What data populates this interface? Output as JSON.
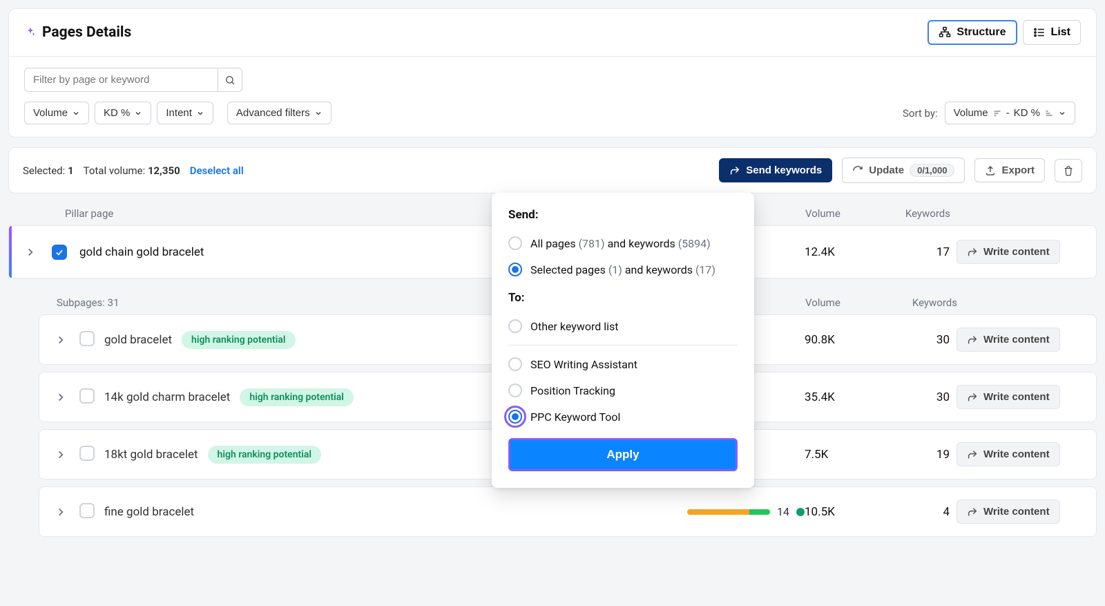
{
  "header": {
    "title": "Pages Details",
    "structure_label": "Structure",
    "list_label": "List"
  },
  "filters": {
    "placeholder": "Filter by page or keyword",
    "volume_label": "Volume",
    "kd_label": "KD %",
    "intent_label": "Intent",
    "advanced_label": "Advanced filters",
    "sortby_label": "Sort by:",
    "sort_value": "Volume",
    "sort_value2": "KD %"
  },
  "selbar": {
    "selected_label": "Selected:",
    "selected_count": "1",
    "total_label": "Total volume:",
    "total_value": "12,350",
    "deselect_label": "Deselect all",
    "send_label": "Send keywords",
    "update_label": "Update",
    "update_badge": "0/1,000",
    "export_label": "Export"
  },
  "columns": {
    "pillar_label": "Pillar page",
    "volume_label": "Volume",
    "keywords_label": "Keywords",
    "subpages_label": "Subpages:",
    "subpages_count": "31"
  },
  "pillar": {
    "title": "gold chain gold bracelet",
    "volume": "12.4K",
    "keywords": "17",
    "write_label": "Write content"
  },
  "subpages": [
    {
      "title": "gold bracelet",
      "tag": "high ranking potential",
      "kd": "",
      "volume": "90.8K",
      "keywords": "30"
    },
    {
      "title": "14k gold charm bracelet",
      "tag": "high ranking potential",
      "kd": "",
      "volume": "35.4K",
      "keywords": "30"
    },
    {
      "title": "18kt gold bracelet",
      "tag": "high ranking potential",
      "kd": "",
      "volume": "7.5K",
      "keywords": "19"
    },
    {
      "title": "fine gold bracelet",
      "tag": "",
      "kd": "14",
      "volume": "10.5K",
      "keywords": "4"
    }
  ],
  "popover": {
    "send_heading": "Send:",
    "opt_all_a": "All pages",
    "opt_all_pages_count": "(781)",
    "opt_all_b": "and keywords",
    "opt_all_kw_count": "(5894)",
    "opt_sel_a": "Selected pages",
    "opt_sel_pages_count": "(1)",
    "opt_sel_b": "and keywords",
    "opt_sel_kw_count": "(17)",
    "to_heading": "To:",
    "to_other": "Other keyword list",
    "to_swa": "SEO Writing Assistant",
    "to_pt": "Position Tracking",
    "to_ppc": "PPC Keyword Tool",
    "apply_label": "Apply"
  }
}
